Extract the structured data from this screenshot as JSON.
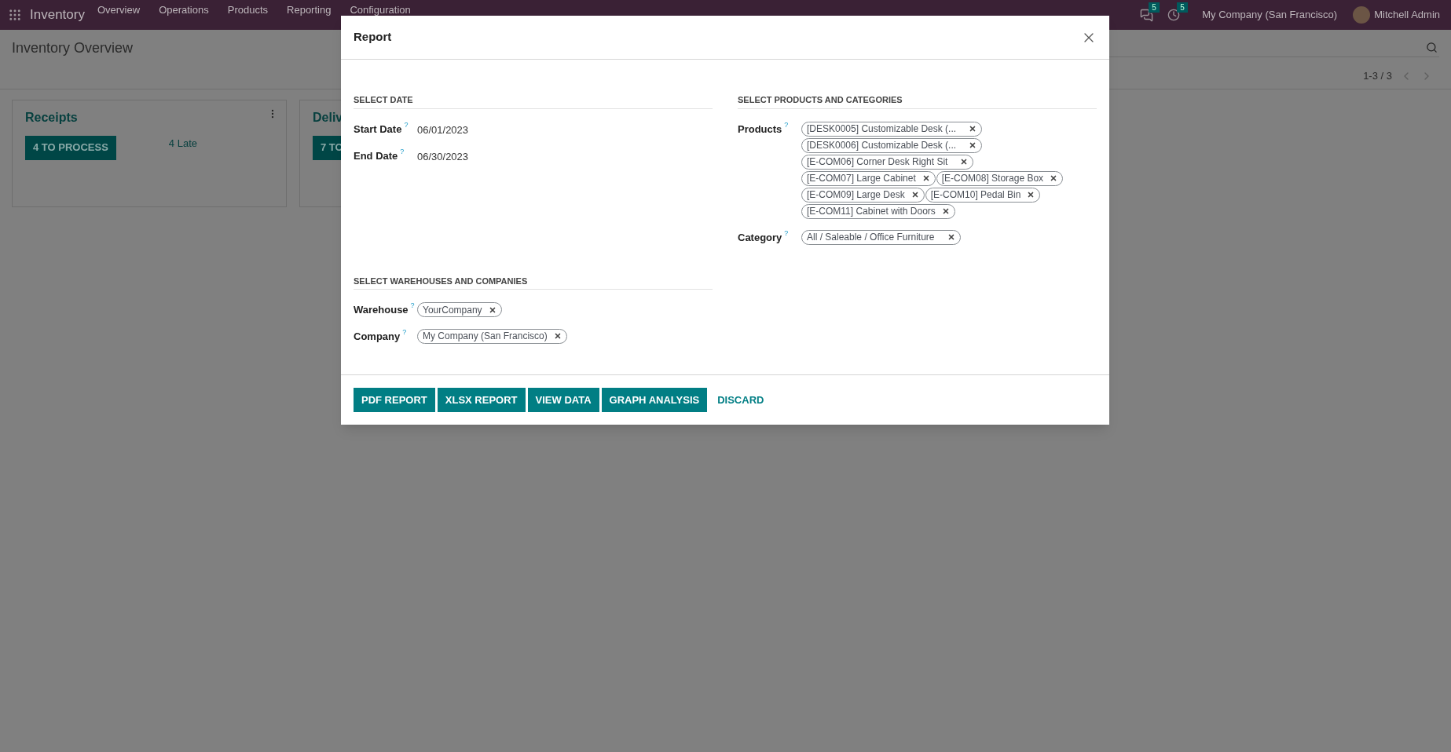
{
  "navbar": {
    "app_name": "Inventory",
    "menu": [
      "Overview",
      "Operations",
      "Products",
      "Reporting",
      "Configuration"
    ],
    "messages_badge": "5",
    "activities_badge": "5",
    "company": "My Company (San Francisco)",
    "user": "Mitchell Admin"
  },
  "page": {
    "title": "Inventory Overview",
    "pager": "1-3 / 3",
    "cards": [
      {
        "title": "Receipts",
        "button": "4 TO PROCESS",
        "late": "4 Late"
      },
      {
        "title": "Deliv",
        "button": "7 TO"
      }
    ]
  },
  "dialog": {
    "title": "Report",
    "columns": [
      [
        {
          "heading": "SELECT DATE",
          "fields": [
            {
              "label": "Start Date",
              "help": "?",
              "kind": "date",
              "value": "06/01/2023"
            },
            {
              "label": "End Date",
              "help": "?",
              "kind": "date",
              "value": "06/30/2023"
            }
          ]
        },
        {
          "heading": "SELECT WAREHOUSES AND COMPANIES",
          "fields": [
            {
              "label": "Warehouse",
              "help": "?",
              "kind": "tags",
              "tags": [
                "YourCompany"
              ]
            },
            {
              "label": "Company",
              "help": "?",
              "kind": "tags",
              "tags": [
                "My Company (San Francisco)"
              ]
            }
          ]
        }
      ],
      [
        {
          "heading": "SELECT PRODUCTS AND CATEGORIES",
          "fields": [
            {
              "label": "Products",
              "help": "?",
              "kind": "tags",
              "tags": [
                "[DESK0005] Customizable Desk (...",
                "[DESK0006] Customizable Desk (...",
                "[E-COM06] Corner Desk Right Sit",
                "[E-COM07] Large Cabinet",
                "[E-COM08] Storage Box",
                "[E-COM09] Large Desk",
                "[E-COM10] Pedal Bin",
                "[E-COM11] Cabinet with Doors"
              ]
            },
            {
              "label": "Category",
              "help": "?",
              "kind": "tags",
              "tags": [
                "All / Saleable / Office Furniture"
              ]
            }
          ]
        }
      ]
    ],
    "buttons": [
      {
        "label": "PDF REPORT",
        "kind": "primary"
      },
      {
        "label": "XLSX REPORT",
        "kind": "primary"
      },
      {
        "label": "VIEW DATA",
        "kind": "primary"
      },
      {
        "label": "GRAPH ANALYSIS",
        "kind": "primary"
      },
      {
        "label": "DISCARD",
        "kind": "link"
      }
    ]
  }
}
